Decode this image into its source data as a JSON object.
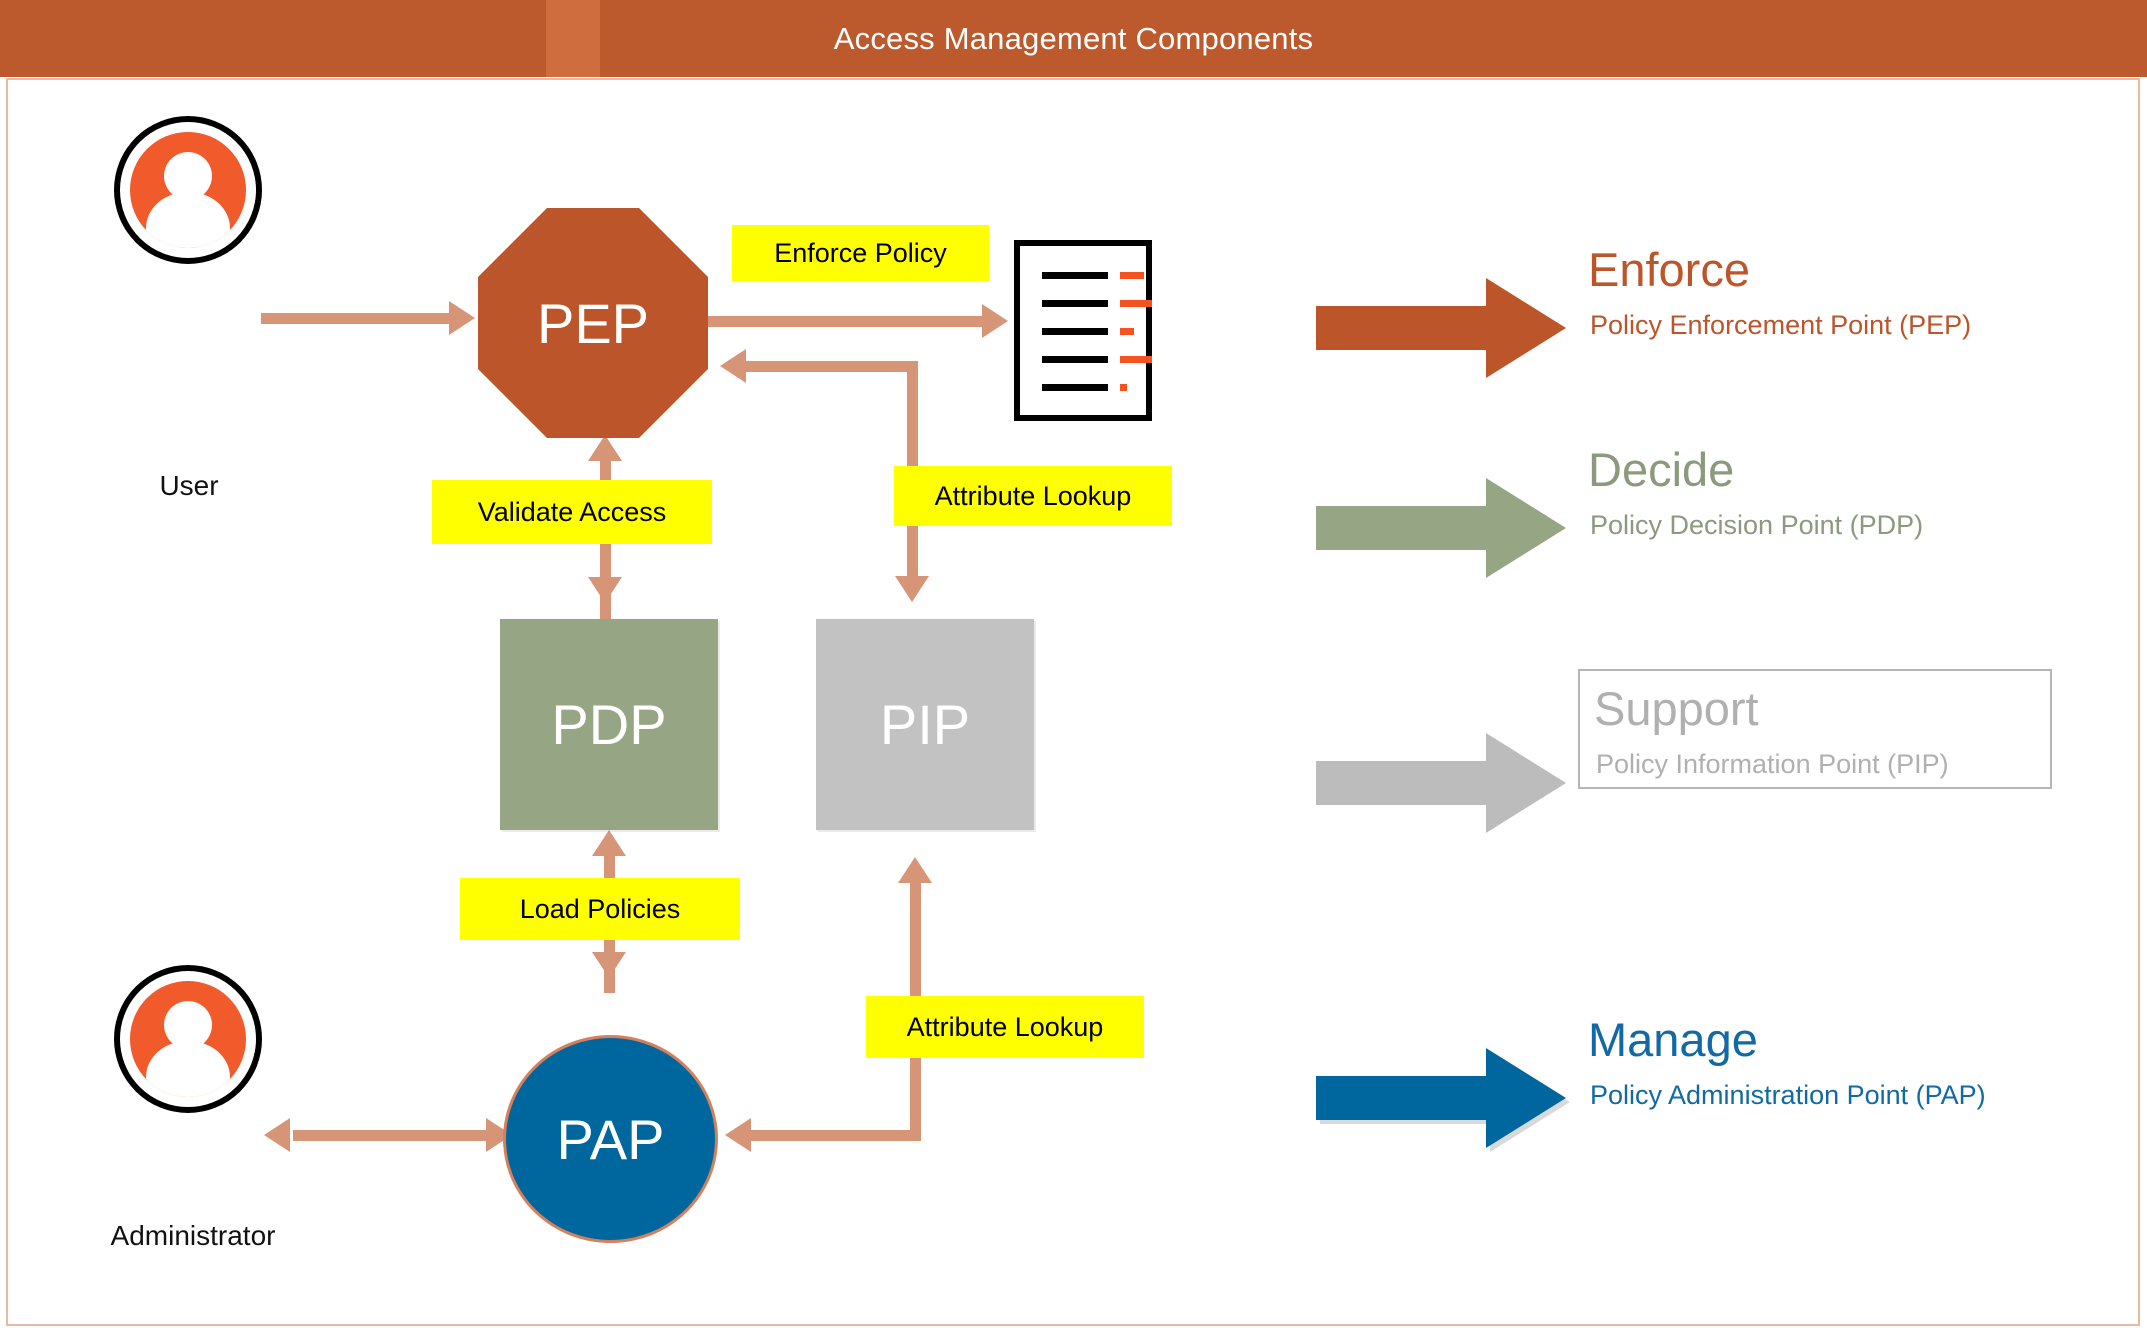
{
  "header": {
    "title": "Access Management Components",
    "bar_color": "#bd5a2d",
    "stripe_color": "#cf6d3e"
  },
  "diagram": {
    "actors": [
      {
        "id": "user",
        "label": "User",
        "icon": "user-avatar-icon",
        "color": "#f15a2b"
      },
      {
        "id": "administrator",
        "label": "Administrator",
        "icon": "user-avatar-icon",
        "color": "#f15a2b"
      }
    ],
    "nodes": [
      {
        "id": "pep",
        "label": "PEP",
        "shape": "octagon",
        "color": "#bc552a"
      },
      {
        "id": "pdp",
        "label": "PDP",
        "shape": "rectangle",
        "color": "#96a684"
      },
      {
        "id": "pip",
        "label": "PIP",
        "shape": "rectangle",
        "color": "#c2c2c2"
      },
      {
        "id": "pap",
        "label": "PAP",
        "shape": "ellipse",
        "color": "#00679e"
      }
    ],
    "document": {
      "id": "policy-document",
      "name": "policy-document-icon"
    },
    "connector_color": "#d79578",
    "tags": [
      {
        "id": "enforce-policy",
        "label": "Enforce Policy"
      },
      {
        "id": "validate-access",
        "label": "Validate Access"
      },
      {
        "id": "attribute-lookup-top",
        "label": "Attribute Lookup"
      },
      {
        "id": "load-policies",
        "label": "Load Policies"
      },
      {
        "id": "attribute-lookup-bottom",
        "label": "Attribute Lookup"
      }
    ],
    "tag_color": "#ffff00"
  },
  "legend": {
    "items": [
      {
        "id": "enforce",
        "title": "Enforce",
        "subtitle": "Policy Enforcement Point (PEP)",
        "color": "#bc552a",
        "boxed": false
      },
      {
        "id": "decide",
        "title": "Decide",
        "subtitle": "Policy Decision Point (PDP)",
        "color": "#96a684",
        "boxed": false
      },
      {
        "id": "support",
        "title": "Support",
        "subtitle": "Policy Information Point (PIP)",
        "color": "#bcbcbc",
        "boxed": true
      },
      {
        "id": "manage",
        "title": "Manage",
        "subtitle": "Policy Administration Point (PAP)",
        "color": "#00679e",
        "boxed": false
      }
    ]
  }
}
